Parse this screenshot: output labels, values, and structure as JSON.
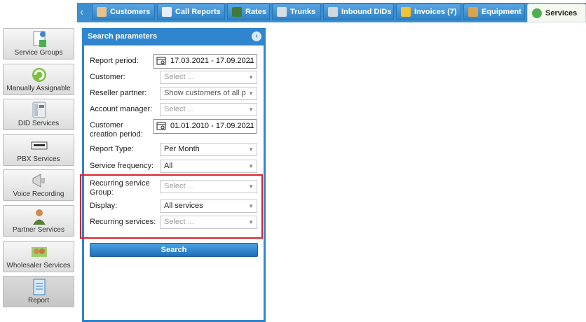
{
  "tabs": [
    {
      "label": "Customers",
      "icon": "customers-icon",
      "active": false
    },
    {
      "label": "Call Reports",
      "icon": "call-reports-icon",
      "active": false
    },
    {
      "label": "Rates",
      "icon": "rates-icon",
      "active": false
    },
    {
      "label": "Trunks",
      "icon": "trunks-icon",
      "active": false
    },
    {
      "label": "Inbound DIDs",
      "icon": "inbound-dids-icon",
      "active": false
    },
    {
      "label": "Invoices (7)",
      "icon": "invoices-icon",
      "active": false
    },
    {
      "label": "Equipment",
      "icon": "equipment-icon",
      "active": false
    },
    {
      "label": "Services",
      "icon": "services-icon",
      "active": true
    }
  ],
  "sidebar": {
    "items": [
      {
        "label": "Service Groups",
        "icon": "service-groups-icon"
      },
      {
        "label": "Manually Assignable",
        "icon": "manually-assignable-icon"
      },
      {
        "label": "DID Services",
        "icon": "did-services-icon"
      },
      {
        "label": "PBX Services",
        "icon": "pbx-services-icon"
      },
      {
        "label": "Voice Recording",
        "icon": "voice-recording-icon"
      },
      {
        "label": "Partner Services",
        "icon": "partner-services-icon"
      },
      {
        "label": "Wholesaler Services",
        "icon": "wholesaler-services-icon"
      },
      {
        "label": "Report",
        "icon": "report-icon"
      }
    ]
  },
  "panel": {
    "title": "Search parameters",
    "fields": {
      "report_period": {
        "label": "Report period:",
        "value": "17.03.2021 - 17.09.2021"
      },
      "customer": {
        "label": "Customer:",
        "placeholder": "Select ..."
      },
      "reseller_partner": {
        "label": "Reseller partner:",
        "value": "Show customers of all p"
      },
      "account_manager": {
        "label": "Account manager:",
        "placeholder": "Select ..."
      },
      "customer_creation_period": {
        "label_line1": "Customer",
        "label_line2": "creation period:",
        "value": "01.01.2010 - 17.09.2021"
      },
      "report_type": {
        "label": "Report Type:",
        "value": "Per Month"
      },
      "service_frequency": {
        "label": "Service frequency:",
        "value": "All"
      },
      "recurring_service_group": {
        "label_line1": "Recurring service",
        "label_line2": "Group:",
        "placeholder": "Select ..."
      },
      "display": {
        "label": "Display:",
        "value": "All services"
      },
      "recurring_services": {
        "label": "Recurring services:",
        "placeholder": "Select ..."
      }
    },
    "search_button": "Search"
  },
  "colors": {
    "accent_blue": "#2f86cf",
    "highlight_red": "#d9222f"
  }
}
